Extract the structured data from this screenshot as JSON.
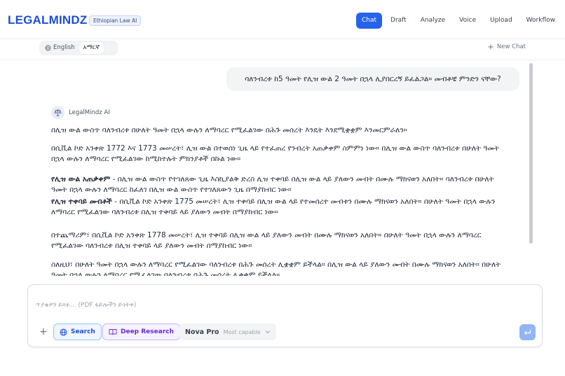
{
  "header": {
    "logo": "LEGALMINDZ",
    "badge": "Ethiopian Law AI",
    "nav": [
      {
        "label": "Chat",
        "active": true
      },
      {
        "label": "Draft",
        "active": false
      },
      {
        "label": "Analyze",
        "active": false
      },
      {
        "label": "Voice",
        "active": false
      },
      {
        "label": "Upload",
        "active": false
      },
      {
        "label": "Workflow",
        "active": false
      }
    ]
  },
  "language": {
    "english": "English",
    "amharic": "አማርኛ",
    "active": "amharic",
    "new_chat": "New Chat"
  },
  "chat": {
    "user_message": "ባለንብረቱ ከ5 ዓመት የሊዝ ውል 2 ዓመት በኋላ ሊያበርረኝ ይፈልጋል። መብቶቼ ምንድን ናቸው?",
    "ai_name": "LegalMindz AI",
    "ai_paragraphs": [
      {
        "bold": "",
        "text": "በሊዝ ውል ውስጥ ባለንብረቱ በሁለት ዓመት በኋላ ውሉን ለማባረር የሚፈልገው በሕጉ መሰረት እንዴት እንደሚቋቋም እንመርምራለን።"
      },
      {
        "bold": "",
        "text": "በሲቪል ኮድ አንቀጽ 1772 እና 1773 መሠረት፣ ሊዝ ውል በተወሰነ ጊዜ ላይ የተፈጠረ የንብረት አጠቃቀም ስምምነ ነው። በሊዝ ውል ውስጥ ባለንብረቱ በሁለት ዓመት በኋላ ውሉን ለማባረር የሚፈልገው ከሚከተሉት ምክንያቶች በኩል ነው።"
      },
      {
        "bold": "የሊዝ ውል አጠቃቀም",
        "text": " - በሊዝ ውል ውስጥ የተገለጸው ጊዜ እስኪያልቅ ድረስ ሊዝ ተቀባይ በሊዝ ውል ላይ ያለውን መብት በሙሉ ማክናወን አለበት። ባለንብረቱ በሁለት ዓመት በኋላ ውሉን ለማባረር ከፈለገ በሊዝ ውል ውስጥ የተገለጸውን ጊዜ በማያከብር ነው።"
      },
      {
        "bold": "የሊዝ ተቀባይ መብቶች",
        "text": " - በሲቪል ኮድ አንቀጽ 1775 መሠረት፣ ሊዝ ተቀባይ በሊዝ ውል ላይ የተመሰረተ መብቱን በሙሉ ማክናወን አለበት። በሁለት ዓመት በኋላ ውሉን ለማባረር የሚፈልገው ባለንብረቱ በሊዝ ተቀባይ ላይ ያለውን መብት በማያከብር ነው።"
      },
      {
        "bold": "",
        "text": "በተጨማሪም፣ በሲቪል ኮድ አንቀጽ 1778 መሠረት፣ ሊዝ ተቀባይ በሊዝ ውል ላይ ያለውን መብት በሙሉ ማክናወን አለበት። በሁለት ዓመት በኋላ ውሉን ለማባረር የሚፈልገው ባለንብረቱ በሊዝ ተቀባይ ላይ ያለውን መብት በማያከብር ነው።"
      },
      {
        "bold": "",
        "text": "ስለዚህ፣ በሁለት ዓመት በኋላ ውሉን ለማባረር የሚፈልገው ባለንብረቱ በሕጉ መሰረት ሊቋቋም ይችላል። በሊዝ ውል ላይ ያለውን መብት በሙሉ ማክናወን አለበት። በሁለት ዓመት በኋላ ውሉን ለማባረር የሚፈልገው ባለንብረቱ በሕጉ መሰረት ሊቋቋም ይችላል።"
      }
    ]
  },
  "composer": {
    "placeholder": "ጥያቄዎን ይጻፉ... (PDF ፋይሎችን ይጎትቱ)",
    "search_label": "Search",
    "research_label": "Deep Research",
    "model_name": "Nova Pro",
    "model_sub": "Most capable"
  },
  "colors": {
    "accent": "#2563eb",
    "search": "#1d4ed8",
    "research": "#6d28d9"
  }
}
